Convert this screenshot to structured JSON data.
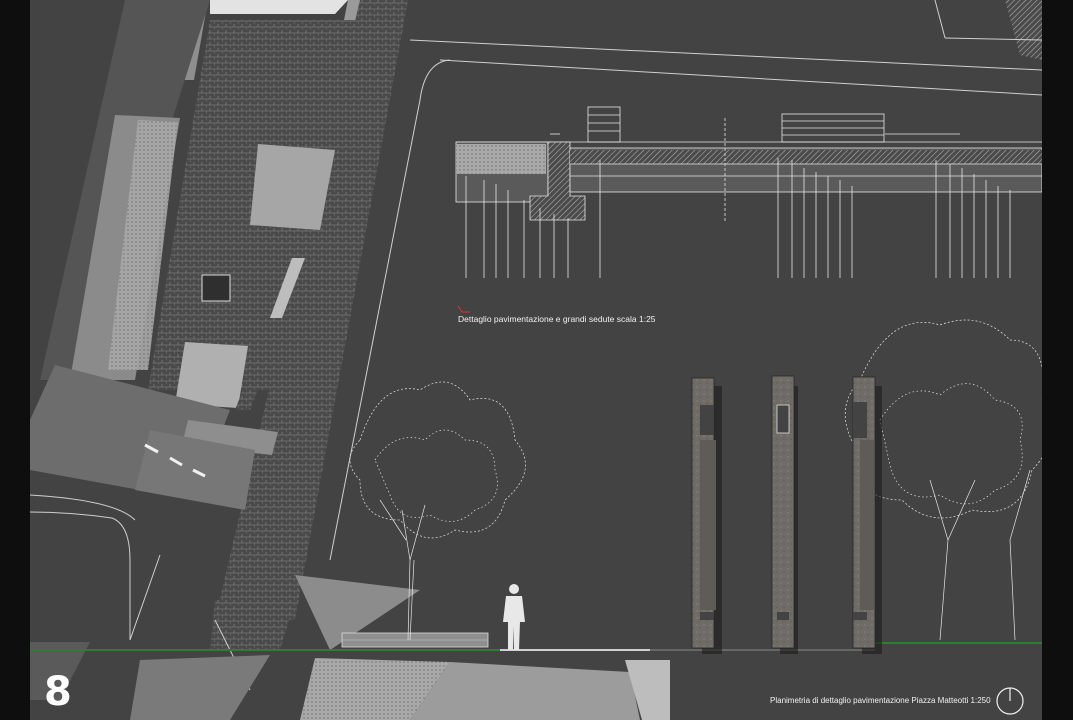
{
  "page_number": "8",
  "section_caption": "Dettaglio pavimentazione e grandi sedute scala 1:25",
  "plan_caption": "Planimetria di dettaglio pavimentazione Piazza Matteotti 1:250",
  "north_symbol": "north-arrow-icon",
  "colors": {
    "sheet": "#434343",
    "border": "#0e0e0e",
    "ground_line": "#2e7d32",
    "lines": "#e6e6e6",
    "pillar": "#6e6a64"
  }
}
